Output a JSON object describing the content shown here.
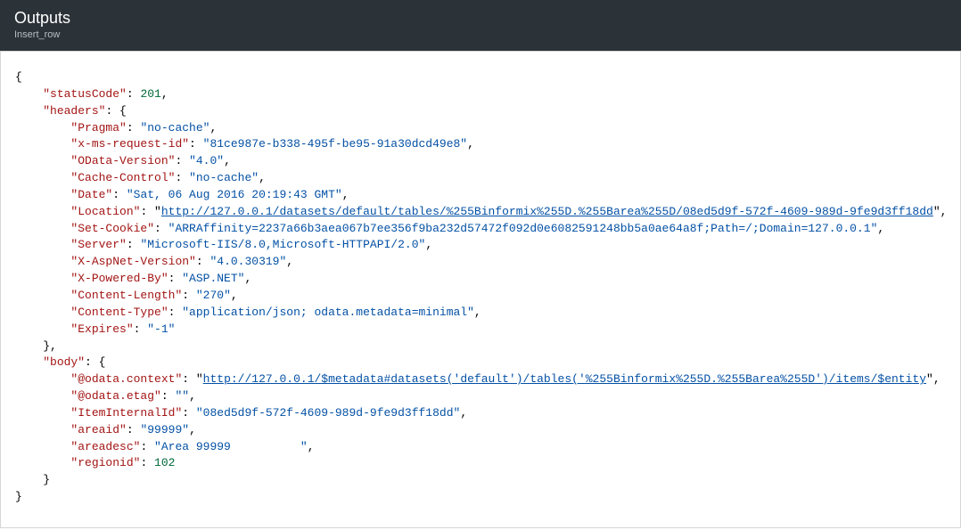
{
  "header": {
    "title": "Outputs",
    "subtitle": "Insert_row"
  },
  "json": {
    "statusCode": 201,
    "headers": {
      "Pragma": "no-cache",
      "x-ms-request-id": "81ce987e-b338-495f-be95-91a30dcd49e8",
      "OData-Version": "4.0",
      "Cache-Control": "no-cache",
      "Date": "Sat, 06 Aug 2016 20:19:43 GMT",
      "Location": "http://127.0.0.1/datasets/default/tables/%255Binformix%255D.%255Barea%255D/08ed5d9f-572f-4609-989d-9fe9d3ff18dd",
      "Set-Cookie": "ARRAffinity=2237a66b3aea067b7ee356f9ba232d57472f092d0e6082591248bb5a0ae64a8f;Path=/;Domain=127.0.0.1",
      "Server": "Microsoft-IIS/8.0,Microsoft-HTTPAPI/2.0",
      "X-AspNet-Version": "4.0.30319",
      "X-Powered-By": "ASP.NET",
      "Content-Length": "270",
      "Content-Type": "application/json; odata.metadata=minimal",
      "Expires": "-1"
    },
    "body": {
      "@odata.context": "http://127.0.0.1/$metadata#datasets('default')/tables('%255Binformix%255D.%255Barea%255D')/items/$entity",
      "@odata.etag": "",
      "ItemInternalId": "08ed5d9f-572f-4609-989d-9fe9d3ff18dd",
      "areaid": "99999",
      "areadesc": "Area 99999          ",
      "regionid": 102
    }
  },
  "links": [
    "Location",
    "@odata.context"
  ]
}
